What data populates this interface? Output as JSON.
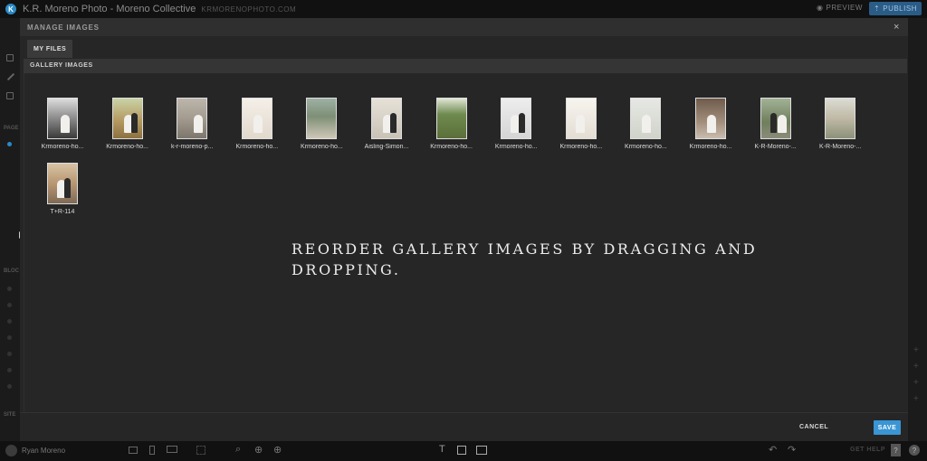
{
  "app": {
    "logo_letter": "K",
    "title": "K.R. Moreno Photo - Moreno Collective",
    "domain": "KRMORENOPHOTO.COM",
    "preview_label": "PREVIEW",
    "publish_label": "PUBLISH"
  },
  "sidebar": {
    "labels": [
      "PAGE",
      "BLOC",
      "SITE"
    ]
  },
  "modal": {
    "title": "MANAGE IMAGES",
    "close_glyph": "×",
    "tab_label": "MY FILES",
    "section_title": "GALLERY IMAGES",
    "hint": "REORDER GALLERY IMAGES BY DRAGGING AND DROPPING.",
    "cancel_label": "CANCEL",
    "save_label": "SAVE",
    "images": [
      {
        "name": "Krmoreno-ho...",
        "palette": "vintage-car"
      },
      {
        "name": "Krmoreno-ho...",
        "palette": "field"
      },
      {
        "name": "k-r-moreno-p...",
        "palette": "stairs"
      },
      {
        "name": "Krmoreno-ho...",
        "palette": "white-room"
      },
      {
        "name": "Krmoreno-ho...",
        "palette": "garden-villa"
      },
      {
        "name": "Aisling-Simon...",
        "palette": "couple-light"
      },
      {
        "name": "Krmoreno-ho...",
        "palette": "willow"
      },
      {
        "name": "Krmoreno-ho...",
        "palette": "couple-kiss"
      },
      {
        "name": "Krmoreno-ho...",
        "palette": "dress-detail"
      },
      {
        "name": "Krmoreno-ho...",
        "palette": "bride-bouquet"
      },
      {
        "name": "Krmoreno-ho...",
        "palette": "archway"
      },
      {
        "name": "K-R-Moreno-...",
        "palette": "couple-garden"
      },
      {
        "name": "K-R-Moreno-...",
        "palette": "chateau"
      },
      {
        "name": "T+R-114",
        "palette": "embrace"
      }
    ]
  },
  "bottombar": {
    "username": "Ryan Moreno",
    "get_help": "GET HELP",
    "help_box": "?",
    "help_circle": "?"
  }
}
